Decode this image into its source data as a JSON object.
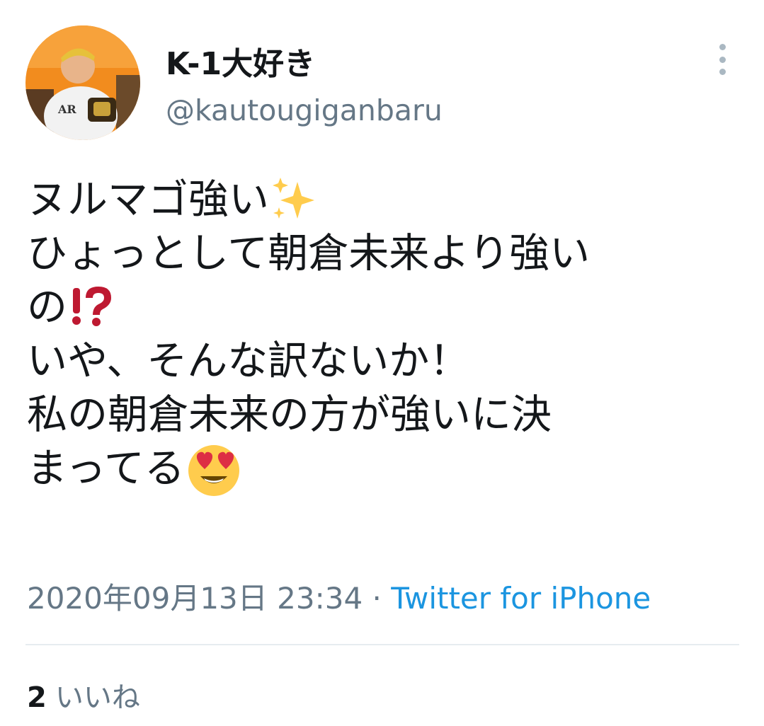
{
  "user": {
    "display_name": "K-1大好き",
    "handle": "@kautougiganbaru",
    "avatar": "profile-photo"
  },
  "tweet": {
    "lines": [
      {
        "text": "ヌルマゴ強い",
        "emoji": "sparkles"
      },
      {
        "text": "ひょっとして朝倉未来より強い",
        "emoji": ""
      },
      {
        "text": "の",
        "emoji": "exclamation-question-mark"
      },
      {
        "text": "いや、そんな訳ないか！",
        "emoji": ""
      },
      {
        "text": "私の朝倉未来の方が強いに決",
        "emoji": ""
      },
      {
        "text": "まってる",
        "emoji": "heart-eyes"
      }
    ]
  },
  "meta": {
    "date": "2020年09月13日",
    "time": "23:34",
    "separator": "·",
    "source": "Twitter for iPhone"
  },
  "stats": {
    "likes_count": "2",
    "likes_label": "いいね"
  },
  "colors": {
    "text": "#14171a",
    "secondary": "#657786",
    "link": "#1b95e0",
    "divider": "#e6ecf0"
  }
}
